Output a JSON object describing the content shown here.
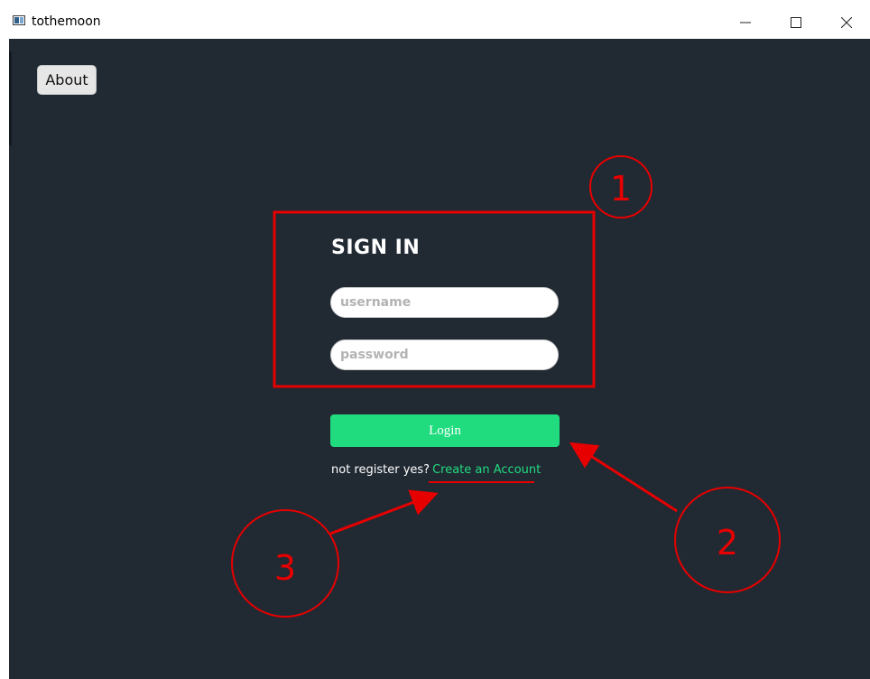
{
  "window": {
    "title": "tothemoon",
    "app_icon": "app-window-icon",
    "controls": {
      "minimize_icon": "minimize-icon",
      "maximize_icon": "maximize-icon",
      "close_icon": "close-icon"
    }
  },
  "toolbar": {
    "about_label": "About"
  },
  "form": {
    "title": "SIGN IN",
    "username_placeholder": "username",
    "password_placeholder": "password",
    "login_label": "Login",
    "register_prompt": "not register yes?",
    "create_account_label": "Create an Account"
  },
  "annotations": {
    "color": "#e60000",
    "callouts": [
      "1",
      "2",
      "3"
    ]
  },
  "colors": {
    "background": "#212933",
    "accent": "#21dc7f",
    "annotation": "#e60000"
  }
}
